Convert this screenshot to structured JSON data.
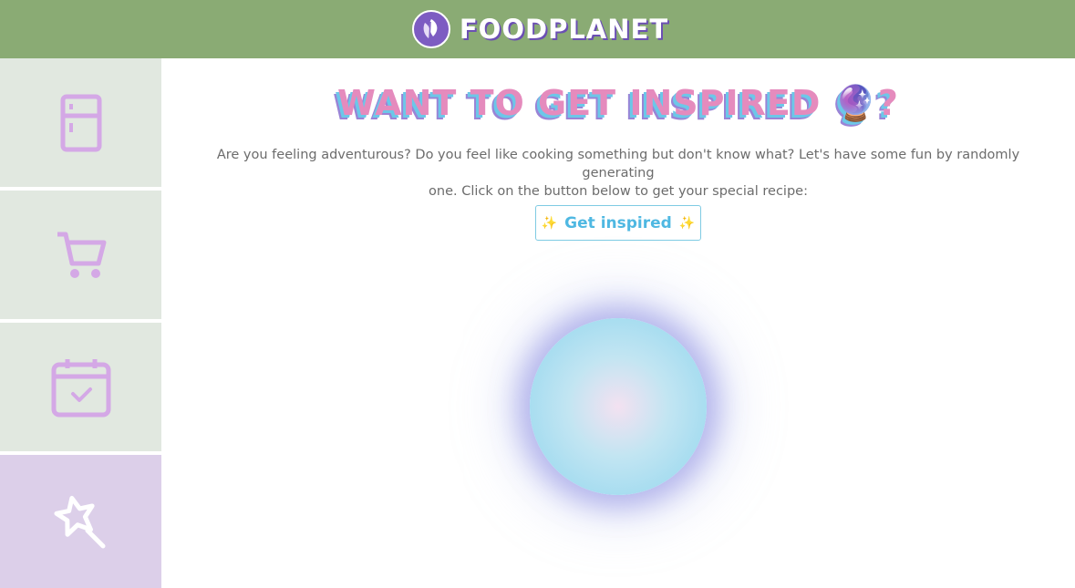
{
  "header": {
    "brand": "FOODPLANET",
    "logo_icon": "leaf-icon"
  },
  "sidebar": {
    "items": [
      {
        "name": "fridge",
        "icon": "fridge-icon",
        "active": false
      },
      {
        "name": "cart",
        "icon": "cart-icon",
        "active": false
      },
      {
        "name": "calendar",
        "icon": "calendar-check-icon",
        "active": false
      },
      {
        "name": "inspire",
        "icon": "magic-wand-icon",
        "active": true
      }
    ]
  },
  "main": {
    "title": "WANT TO GET INSPIRED 🔮?",
    "intro_line1": "Are you feeling adventurous? Do you feel like cooking something but don't know what? Let's have some fun by randomly generating",
    "intro_line2": "one. Click on the button below to get your special recipe:",
    "button": {
      "sparkle_left": "✨",
      "label": "Get inspired",
      "sparkle_right": "✨"
    }
  },
  "colors": {
    "header_bg": "#8aab74",
    "sidebar_bg": "#e1e8e0",
    "sidebar_active_bg": "#dccfe9",
    "icon_purple": "#d4a8e6",
    "title_pink": "#e58bbd",
    "title_shadow_blue": "#6cc7e8",
    "button_text": "#4fb8e2"
  }
}
